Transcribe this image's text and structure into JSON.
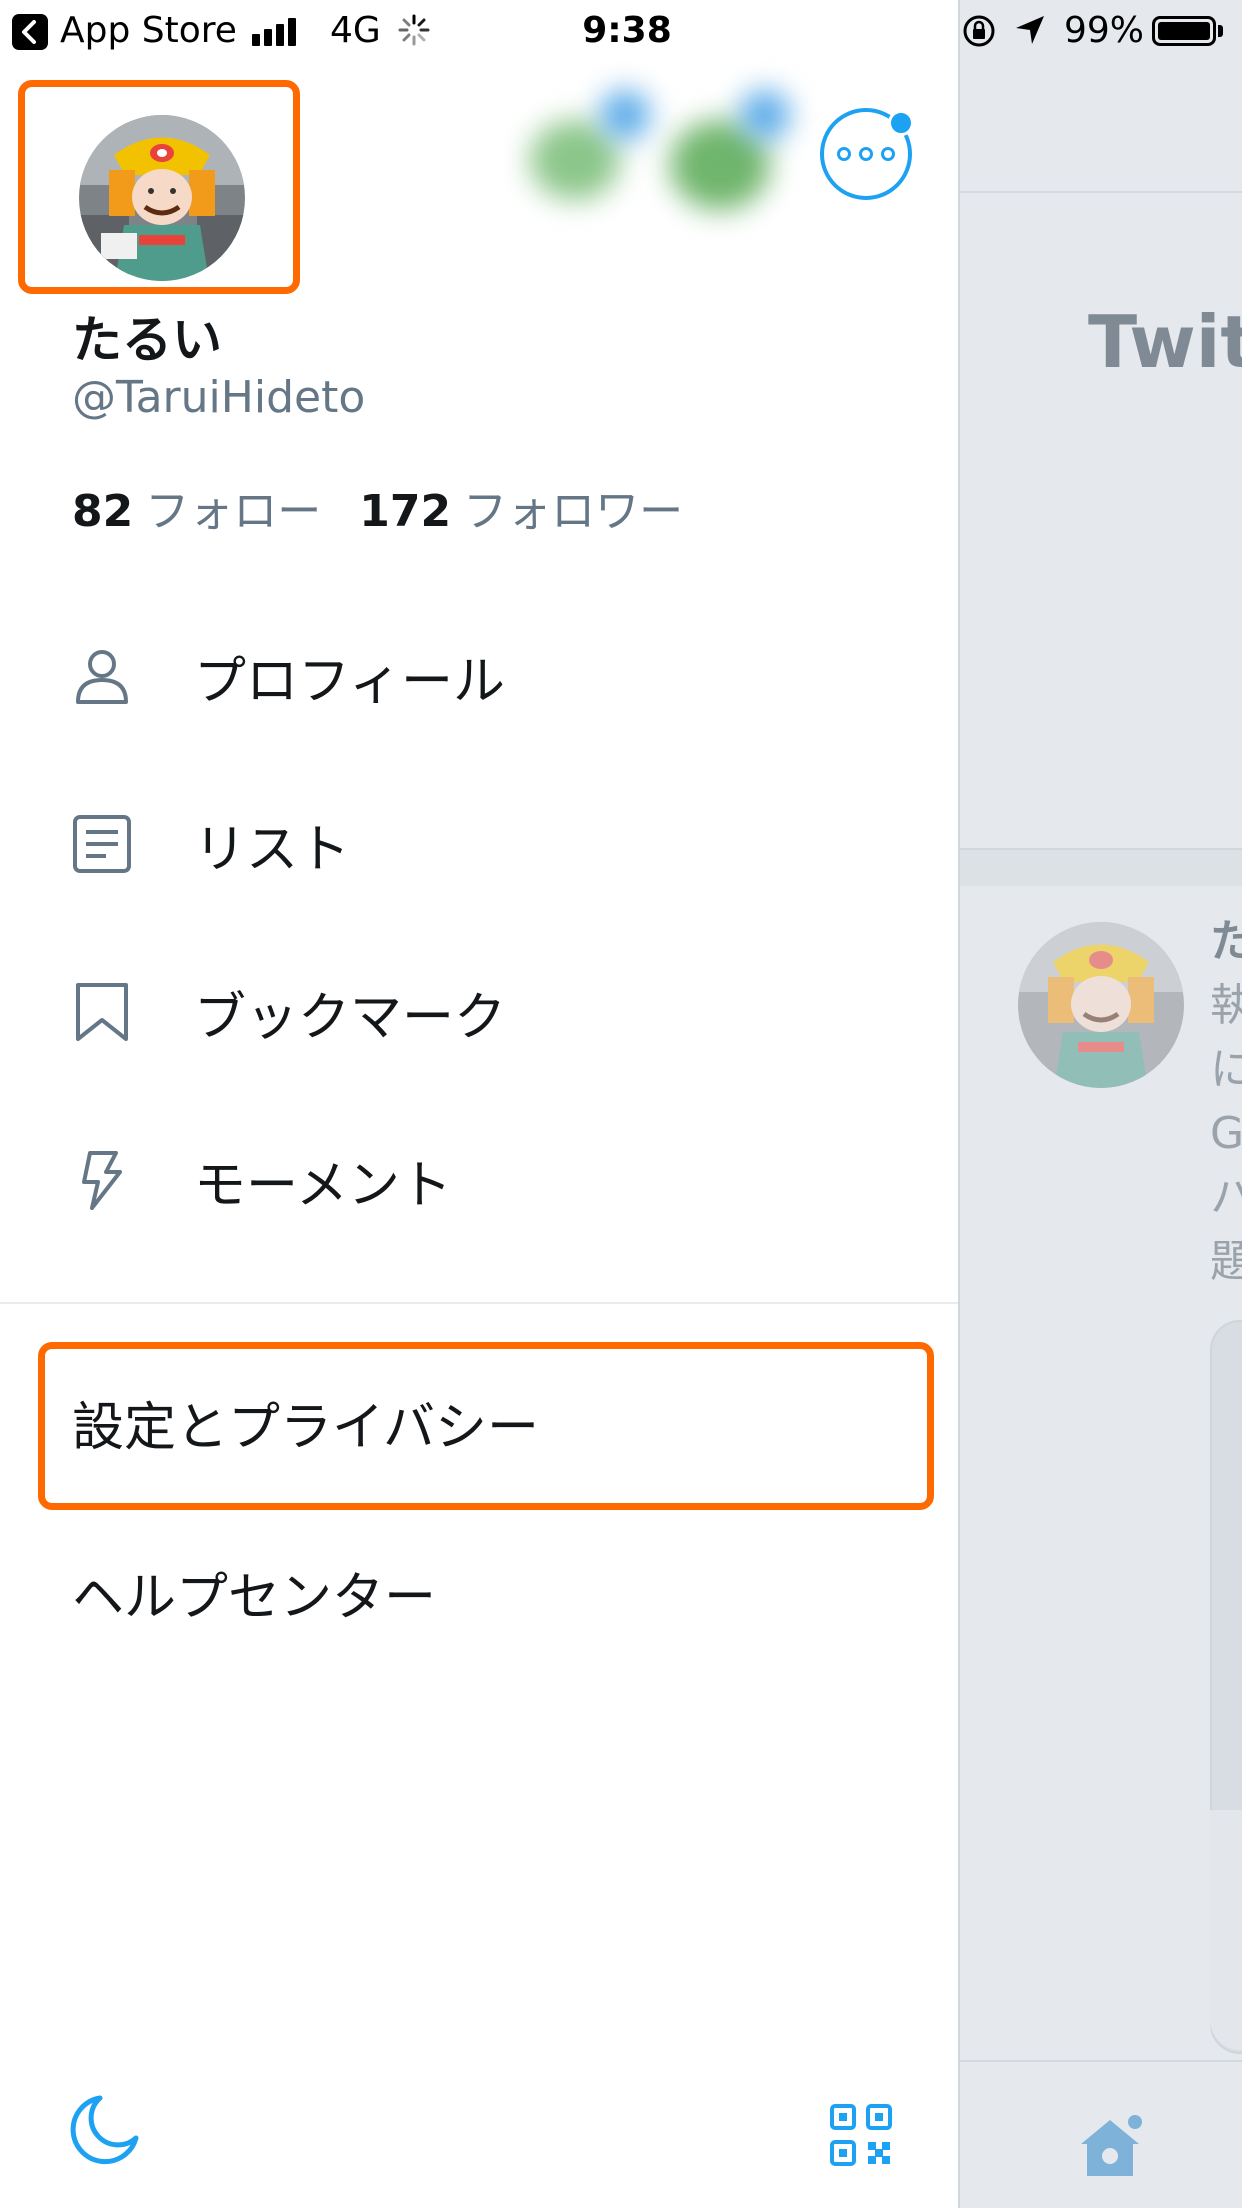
{
  "status_bar": {
    "back_app": "App Store",
    "network": "4G",
    "time": "9:38",
    "battery": "99%"
  },
  "profile": {
    "display_name": "たるい",
    "handle": "@TaruiHideto",
    "following_count": "82",
    "following_label": "フォロー",
    "followers_count": "172",
    "followers_label": "フォロワー"
  },
  "menu": {
    "items": [
      {
        "label": "プロフィール",
        "icon": "person-icon"
      },
      {
        "label": "リスト",
        "icon": "list-icon"
      },
      {
        "label": "ブックマーク",
        "icon": "bookmark-icon"
      },
      {
        "label": "モーメント",
        "icon": "lightning-icon"
      }
    ],
    "settings_label": "設定とプライバシー",
    "help_label": "ヘルプセンター"
  },
  "bottom": {
    "night_mode_icon": "moon-icon",
    "qr_icon": "qr-code-icon"
  },
  "timeline": {
    "title": "Twitt",
    "tweet_lines": [
      "た",
      "執",
      "に",
      "G",
      "ハ",
      "題"
    ]
  },
  "colors": {
    "accent": "#1da1f2",
    "highlight": "#ff6a00",
    "text_primary": "#14171a",
    "text_secondary": "#657786"
  }
}
